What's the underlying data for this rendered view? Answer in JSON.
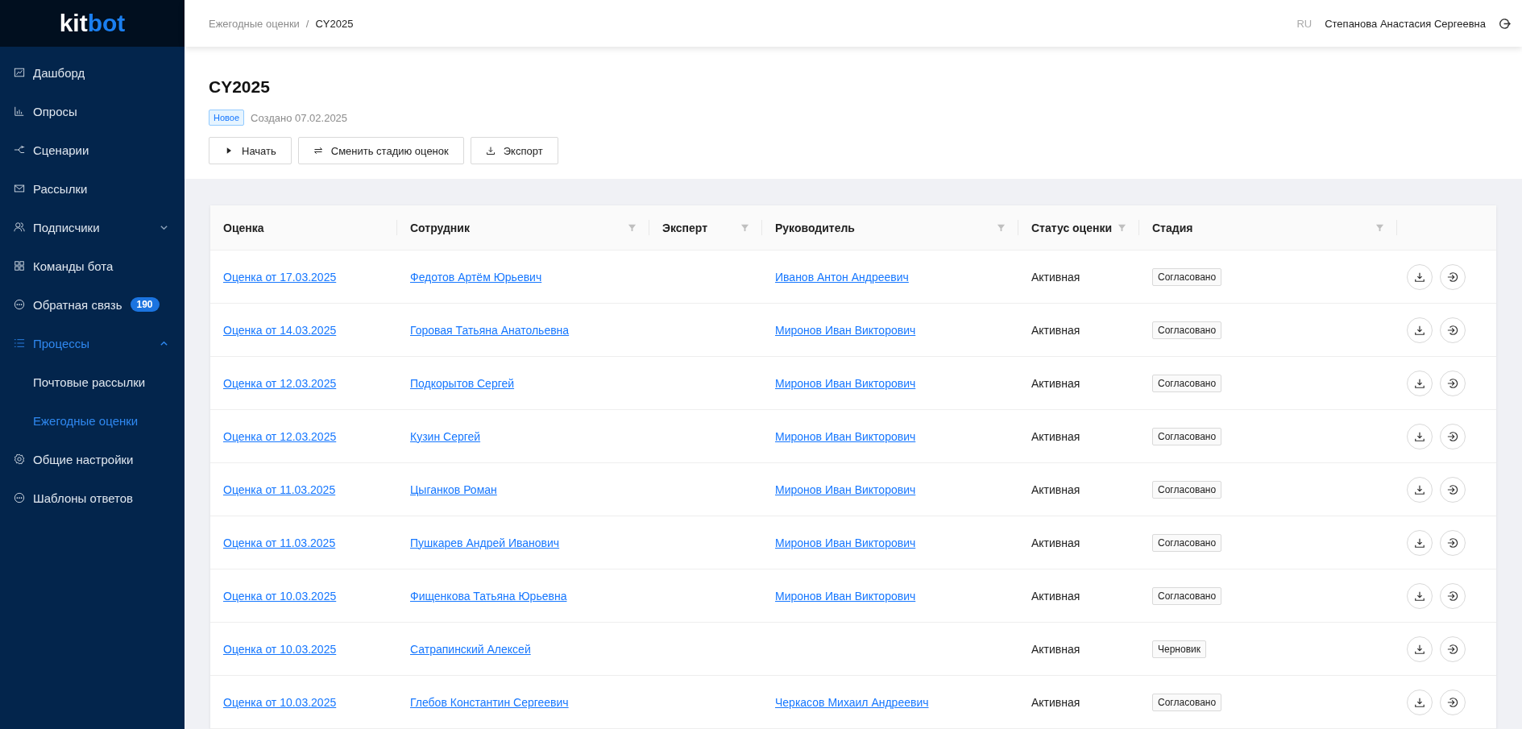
{
  "logo": {
    "part_1": "kit",
    "part_2": "bot"
  },
  "sidebar": {
    "items": [
      {
        "label": "Дашборд",
        "selected": false
      },
      {
        "label": "Опросы",
        "selected": false
      },
      {
        "label": "Сценарии",
        "selected": false
      },
      {
        "label": "Рассылки",
        "selected": false
      },
      {
        "label": "Подписчики",
        "selected": false,
        "expanded": false
      },
      {
        "label": "Команды бота",
        "selected": false
      },
      {
        "label": "Обратная связь",
        "selected": false,
        "badge": "190"
      },
      {
        "label": "Процессы",
        "selected": true,
        "expanded": true,
        "children": [
          {
            "label": "Почтовые рассылки",
            "selected": false
          },
          {
            "label": "Ежегодные оценки",
            "selected": true
          }
        ]
      },
      {
        "label": "Общие настройки",
        "selected": false
      },
      {
        "label": "Шаблоны ответов",
        "selected": false
      }
    ]
  },
  "header": {
    "breadcrumb": [
      "Ежегодные оценки",
      "CY2025"
    ],
    "separator": "/",
    "language": {
      "label": "RU",
      "disabled": true
    },
    "user": "Степанова Анастасия Сергеевна"
  },
  "page": {
    "title": "CY2025",
    "status_tag": "Новое",
    "created": "Создано 07.02.2025",
    "buttons": [
      {
        "label": "Начать"
      },
      {
        "label": "Сменить стадию оценок"
      },
      {
        "label": "Экспорт"
      }
    ]
  },
  "table": {
    "columns": [
      {
        "label": "Оценка",
        "filter": false
      },
      {
        "label": "Сотрудник",
        "filter": true
      },
      {
        "label": "Эксперт",
        "filter": true
      },
      {
        "label": "Руководитель",
        "filter": true
      },
      {
        "label": "Статус оценки",
        "filter": true
      },
      {
        "label": "Стадия",
        "filter": true
      }
    ],
    "rows": [
      {
        "assessment": "Оценка от 17.03.2025",
        "employee": "Федотов Артём Юрьевич",
        "expert": "",
        "manager": "Иванов Антон Андреевич",
        "status": "Активная",
        "stage": "Согласовано"
      },
      {
        "assessment": "Оценка от 14.03.2025",
        "employee": "Горовая Татьяна Анатольевна",
        "expert": "",
        "manager": "Миронов Иван Викторович",
        "status": "Активная",
        "stage": "Согласовано"
      },
      {
        "assessment": "Оценка от 12.03.2025",
        "employee": "Подкорытов Сергей",
        "expert": "",
        "manager": "Миронов Иван Викторович",
        "status": "Активная",
        "stage": "Согласовано"
      },
      {
        "assessment": "Оценка от 12.03.2025",
        "employee": "Кузин Сергей",
        "expert": "",
        "manager": "Миронов Иван Викторович",
        "status": "Активная",
        "stage": "Согласовано"
      },
      {
        "assessment": "Оценка от 11.03.2025",
        "employee": "Цыганков Роман",
        "expert": "",
        "manager": "Миронов Иван Викторович",
        "status": "Активная",
        "stage": "Согласовано"
      },
      {
        "assessment": "Оценка от 11.03.2025",
        "employee": "Пушкарев Андрей Иванович",
        "expert": "",
        "manager": "Миронов Иван Викторович",
        "status": "Активная",
        "stage": "Согласовано"
      },
      {
        "assessment": "Оценка от 10.03.2025",
        "employee": "Фищенкова Татьяна Юрьевна",
        "expert": "",
        "manager": "Миронов Иван Викторович",
        "status": "Активная",
        "stage": "Согласовано"
      },
      {
        "assessment": "Оценка от 10.03.2025",
        "employee": "Сатрапинский Алексей",
        "expert": "",
        "manager": "",
        "status": "Активная",
        "stage": "Черновик"
      },
      {
        "assessment": "Оценка от 10.03.2025",
        "employee": "Глебов Константин Сергеевич",
        "expert": "",
        "manager": "Черкасов Михаил Андреевич",
        "status": "Активная",
        "stage": "Согласовано"
      }
    ]
  }
}
